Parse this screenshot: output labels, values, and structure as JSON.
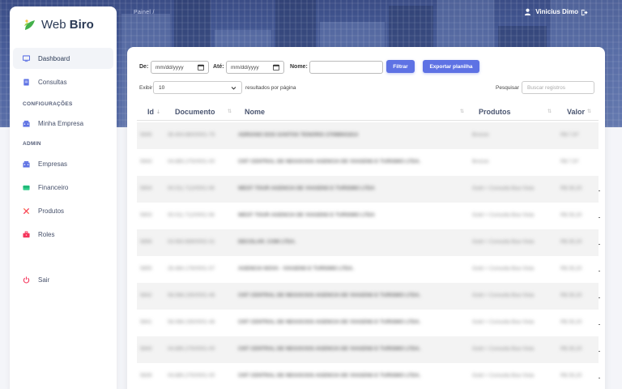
{
  "header": {
    "breadcrumb": "Painel  /",
    "user_name": "Vinicius Dimo"
  },
  "sidebar": {
    "brand_first": "Web ",
    "brand_second": "Biro",
    "items": [
      {
        "label": "Dashboard",
        "icon": "monitor-icon",
        "active": true
      },
      {
        "label": "Consultas",
        "icon": "document-icon"
      }
    ],
    "section_config": "CONFIGURAÇÕES",
    "config_items": [
      {
        "label": "Minha Empresa",
        "icon": "building-icon"
      }
    ],
    "section_admin": "ADMIN",
    "admin_items": [
      {
        "label": "Empresas",
        "icon": "building-icon"
      },
      {
        "label": "Financeiro",
        "icon": "card-icon"
      },
      {
        "label": "Produtos",
        "icon": "tools-icon"
      },
      {
        "label": "Roles",
        "icon": "briefcase-icon"
      }
    ],
    "logout_label": "Sair"
  },
  "filters": {
    "from_label": "De:",
    "to_label": "Até:",
    "from_placeholder": "mm/dd/yyyy",
    "to_placeholder": "mm/dd/yyyy",
    "name_label": "Nome:",
    "name_value": "",
    "filter_button": "Filtrar",
    "export_button": "Exportar planilha"
  },
  "table_controls": {
    "show_label": "Exibir",
    "page_size": "10",
    "per_page_label": "resultados por página",
    "search_label": "Pesquisar",
    "search_placeholder": "Buscar registros"
  },
  "table": {
    "columns": [
      "Id",
      "Documento",
      "Nome",
      "Produtos",
      "Valor"
    ],
    "rows": [
      {
        "id": "5945",
        "doc": "35.404.860/0001-75",
        "name": "ADRIANO DOS SANTOS TENORIO 27098941814",
        "product": "Bronze",
        "value": "R$ 7,97"
      },
      {
        "id": "5943",
        "doc": "04.885.275/0001-00",
        "name": "CNT CENTRAL DE NEGOCIOS AGENCIA DE VIAGENS E TURISMO LTDA.",
        "product": "Bronze",
        "value": "R$ 7,97"
      },
      {
        "id": "5904",
        "doc": "00.011.712/0001-06",
        "name": "WEST TOUR AGENCIA DE VIAGENS E TURISMO LTDA",
        "product": "Gold + Consulta Boa Vista",
        "value": "R$ 35,20"
      },
      {
        "id": "5903",
        "doc": "00.011.712/0001-06",
        "name": "WEST TOUR AGENCIA DE VIAGENS E TURISMO LTDA",
        "product": "Gold + Consulta Boa Vista",
        "value": "R$ 35,20"
      },
      {
        "id": "5856",
        "doc": "03.563.689/0002-31",
        "name": "DECOLAR. COM LTDA.",
        "product": "Gold + Consulta Boa Vista",
        "value": "R$ 35,20"
      },
      {
        "id": "5855",
        "doc": "26.484.176/0001-57",
        "name": "AGENCIA NOVA - VIAGENS E TURISMO LTDA.",
        "product": "Gold + Consulta Boa Vista",
        "value": "R$ 35,20"
      },
      {
        "id": "5842",
        "doc": "58.088.235/0001-46",
        "name": "CNT CENTRAL DE NEGOCIOS AGENCIA DE VIAGENS E TURISMO LTDA.",
        "product": "Gold + Consulta Boa Vista",
        "value": "R$ 35,20"
      },
      {
        "id": "5841",
        "doc": "58.088.235/0001-46",
        "name": "CNT CENTRAL DE NEGOCIOS AGENCIA DE VIAGENS E TURISMO LTDA.",
        "product": "Gold + Consulta Boa Vista",
        "value": "R$ 35,20"
      },
      {
        "id": "5840",
        "doc": "04.885.275/0001-00",
        "name": "CNT CENTRAL DE NEGOCIOS AGENCIA DE VIAGENS E TURISMO LTDA.",
        "product": "Gold + Consulta Boa Vista",
        "value": "R$ 35,20"
      },
      {
        "id": "5839",
        "doc": "04.885.275/0001-00",
        "name": "CNT CENTRAL DE NEGOCIOS AGENCIA DE VIAGENS E TURISMO LTDA.",
        "product": "Gold + Consulta Boa Vista",
        "value": "R$ 35,20"
      }
    ]
  },
  "colors": {
    "accent": "#5e72e4",
    "header_bg": "#4a5f9c",
    "logout_icon": "#f5365c"
  }
}
